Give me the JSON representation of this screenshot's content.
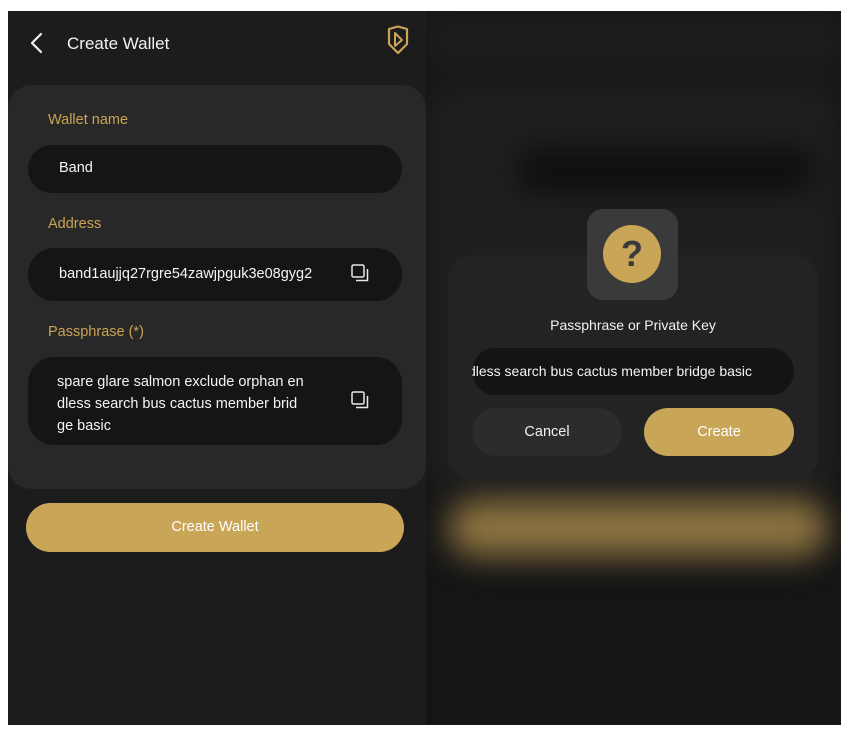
{
  "header": {
    "title": "Create Wallet"
  },
  "form": {
    "wallet_name": {
      "label": "Wallet name",
      "value": "Band"
    },
    "address": {
      "label": "Address",
      "value": "band1aujjq27rgre54zawjpguk3e08gyg2"
    },
    "passphrase": {
      "label": "Passphrase (*)",
      "lines": [
        "spare glare salmon exclude orphan en",
        "dless search bus cactus member brid",
        "ge basic"
      ]
    }
  },
  "create_wallet_button": "Create Wallet",
  "dialog": {
    "icon_glyph": "?",
    "title": "Passphrase or Private Key",
    "input_value": "spare glare salmon exclude orphan endless search bus cactus member bridge basic",
    "cancel_label": "Cancel",
    "create_label": "Create"
  },
  "icons": {
    "back": "chevron-left-icon",
    "brand": "band-logo-icon",
    "copy": "copy-icon",
    "help": "question-icon"
  },
  "colors": {
    "accent": "#c9a557",
    "background": "#1c1c1c",
    "card": "#282828",
    "input": "#151515",
    "label": "#c9a455"
  }
}
